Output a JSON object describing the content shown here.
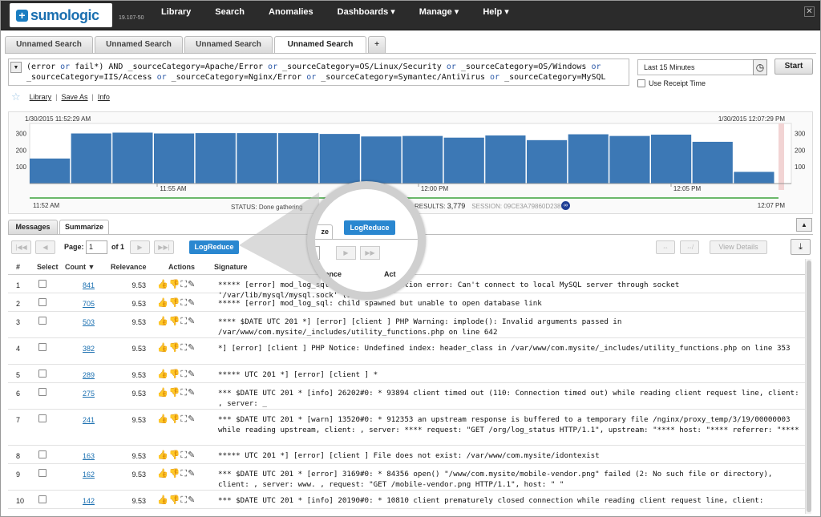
{
  "app": {
    "logo_text": "sumologic",
    "logo_mark": "+",
    "version": "19.107-50",
    "nav": [
      "Library",
      "Search",
      "Anomalies",
      "Dashboards ▾",
      "Manage ▾",
      "Help ▾"
    ],
    "close_icon": "✕"
  },
  "tabs": [
    "Unnamed Search",
    "Unnamed Search",
    "Unnamed Search",
    "Unnamed Search"
  ],
  "tab_add": "+",
  "query": {
    "line1_a": "(error ",
    "line1_or1": "or",
    "line1_b": " fail*) AND _sourceCategory=Apache/Error ",
    "line1_or2": "or",
    "line1_c": " _sourceCategory=OS/Linux/Security ",
    "line1_or3": "or",
    "line1_d": " _sourceCategory=OS/Windows ",
    "line1_or4": "or",
    "line2_a": "_sourceCategory=IIS/Access ",
    "line2_or1": "or",
    "line2_b": " _sourceCategory=Nginx/Error ",
    "line2_or2": "or",
    "line2_c": " _sourceCategory=Symantec/AntiVirus ",
    "line2_or3": "or",
    "line2_d": " _sourceCategory=MySQL",
    "time_range": "Last 15 Minutes",
    "start_label": "Start",
    "receipt_label": "Use Receipt Time"
  },
  "links": [
    "Library",
    "Save As",
    "Info"
  ],
  "histogram": {
    "start_label": "1/30/2015 11:52:29 AM",
    "end_label": "1/30/2015 12:07:29 PM",
    "y_ticks": [
      "300",
      "200",
      "100"
    ],
    "x_ticks": [
      "11:55 AM",
      "12:00 PM",
      "12:05 PM"
    ],
    "axis_start": "11:52 AM",
    "axis_end": "12:07 PM",
    "bars": [
      150,
      300,
      305,
      300,
      302,
      302,
      302,
      297,
      282,
      285,
      275,
      288,
      260,
      295,
      285,
      293,
      250,
      70
    ],
    "bar_color": "#3c78b5",
    "status_label": "STATUS:",
    "status_value": "Done gathering",
    "results_label": "RESULTS:",
    "results_value": "3,779",
    "session_label": "SESSION:",
    "session_value": "09CE3A79860D2389"
  },
  "subtabs": [
    "Messages",
    "Summarize"
  ],
  "collapse_icon": "▲",
  "pager": {
    "first": "|◀◀",
    "prev": "◀",
    "next": "▶",
    "last": "▶▶|",
    "page_label": "Page:",
    "page_value": "1",
    "of_label": "of 1",
    "logreduce_label": "LogReduce",
    "view_details": "View Details",
    "download_icon": "⤓"
  },
  "table": {
    "headers": [
      "#",
      "Select",
      "Count ▼",
      "Relevance",
      "Actions",
      "Signature"
    ],
    "actions_glyphs": "👍👎⛶✎",
    "rows": [
      {
        "n": "1",
        "count": "841",
        "rel": "9.53",
        "sig": "***** [error] mod_log_sql: database connection error: Can't connect to local MySQL server through socket '/var/lib/mysql/mysql.sock' (13)"
      },
      {
        "n": "2",
        "count": "705",
        "rel": "9.53",
        "sig": "***** [error] mod_log_sql: child spawned but unable to open database link"
      },
      {
        "n": "3",
        "count": "503",
        "rel": "9.53",
        "sig": "**** $DATE UTC 201 *] [error] [client            ] PHP Warning:  implode(): Invalid arguments passed in /var/www/com.mysite/_includes/utility_functions.php on line 642"
      },
      {
        "n": "4",
        "count": "382",
        "rel": "9.53",
        "sig": "*] [error] [client            ] PHP Notice:  Undefined index: header_class in /var/www/com.mysite/_includes/utility_functions.php on line 353"
      },
      {
        "n": "5",
        "count": "289",
        "rel": "9.53",
        "sig": "***** UTC 201 *] [error] [client              ] *"
      },
      {
        "n": "6",
        "count": "275",
        "rel": "9.53",
        "sig": "*** $DATE UTC 201 * [info] 26202#0: * 93894 client timed out (110: Connection timed out) while reading client request line, client:             , server: _"
      },
      {
        "n": "7",
        "count": "241",
        "rel": "9.53",
        "sig": "*** $DATE UTC 201 * [warn] 13520#0: * 912353 an upstream response is buffered to a temporary file /nginx/proxy_temp/3/19/00000003 while reading upstream, client:               , server: **** request: \"GET /org/log_status HTTP/1.1\", upstream: \"**** host: \"**** referrer: \"****"
      },
      {
        "n": "8",
        "count": "163",
        "rel": "9.53",
        "sig": "***** UTC 201 *] [error] [client              ] File does not exist: /var/www/com.mysite/idontexist"
      },
      {
        "n": "9",
        "count": "162",
        "rel": "9.53",
        "sig": "*** $DATE UTC 201 * [error] 3169#0: * 84356 open() \"/www/com.mysite/mobile-vendor.png\" failed (2: No such file or directory), client:             , server: www.            , request: \"GET /mobile-vendor.png HTTP/1.1\", host: \"                \""
      },
      {
        "n": "10",
        "count": "142",
        "rel": "9.53",
        "sig": "*** $DATE UTC 201 * [info] 20190#0: * 10810 client prematurely closed connection while reading client request line, client:"
      }
    ]
  },
  "magnifier": {
    "tab_fragment": "ze",
    "logreduce_label": "LogReduce",
    "col_relevance": "levance",
    "col_actions": "Act"
  }
}
